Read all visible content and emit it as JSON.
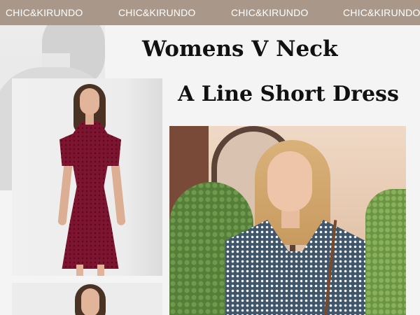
{
  "banner": {
    "brands": [
      "CHIC&KIRUNDO",
      "CHIC&KIRUNDO",
      "CHIC&KIRUNDO",
      "CHIC&KIRUNDO"
    ],
    "background_color": "#a9988a",
    "text_color": "#ffffff"
  },
  "headline": {
    "line1": "Womens V Neck",
    "line2": "A Line Short Dress"
  },
  "photos": [
    {
      "subject": "model in burgundy polka-dot V-neck dress"
    },
    {
      "subject": "model in navy floral V-neck dress"
    },
    {
      "subject": "model portrait (partial)"
    }
  ]
}
